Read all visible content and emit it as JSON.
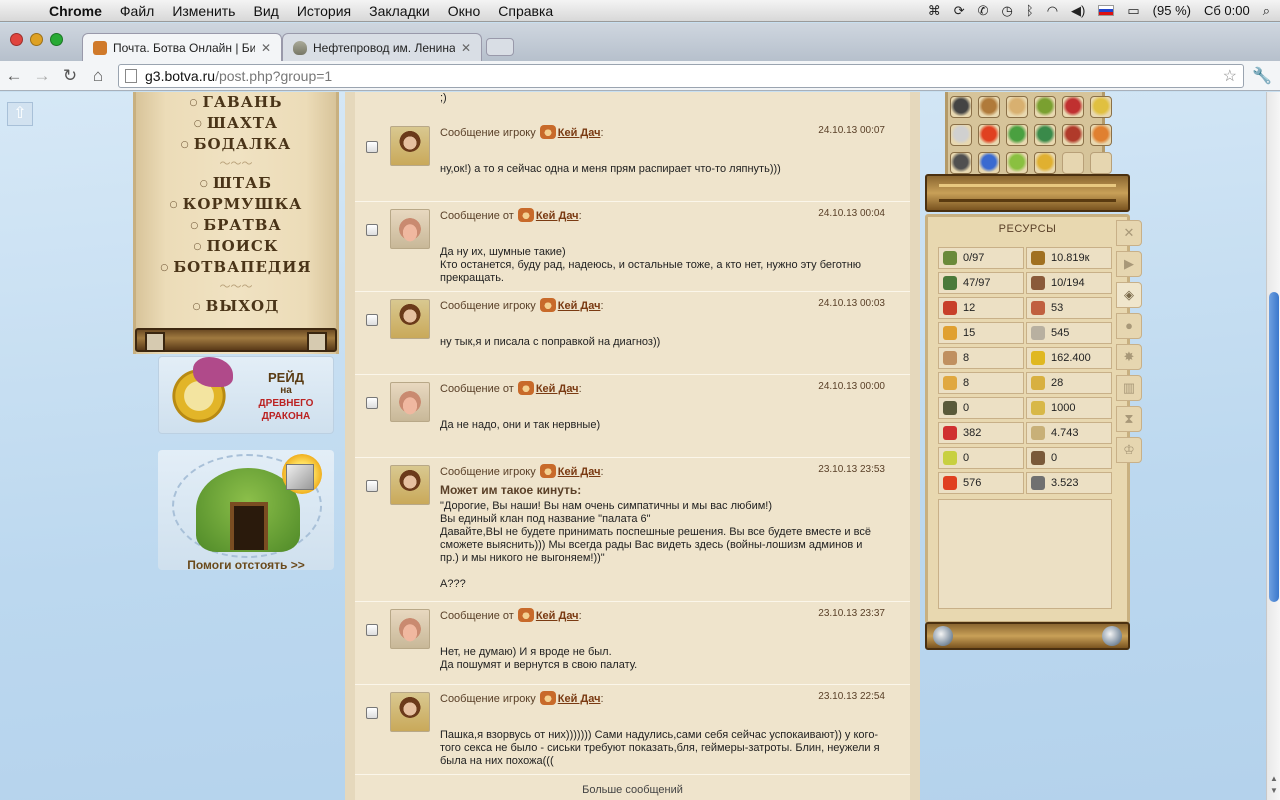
{
  "menubar": {
    "app": "Chrome",
    "items": [
      "Файл",
      "Изменить",
      "Вид",
      "История",
      "Закладки",
      "Окно",
      "Справка"
    ],
    "battery": "(95 %)",
    "clock": "Сб 0:00"
  },
  "tabs": [
    {
      "title": "Почта. Ботва Онлайн | Битва"
    },
    {
      "title": "Нефтепровод им. Ленина"
    }
  ],
  "address": {
    "host": "g3.botva.ru",
    "path": "/post.php?group=1"
  },
  "left_menu": {
    "items_top": [
      "ГАВАНЬ",
      "ШАХТА",
      "БОДАЛКА"
    ],
    "items_mid": [
      "ШТАБ",
      "КОРМУШКА",
      "БРАТВА",
      "ПОИСК",
      "БОТВАПЕДИЯ"
    ],
    "items_bot": [
      "ВЫХОД"
    ]
  },
  "promos": {
    "raid": {
      "line1": "РЕЙД",
      "line2": "на",
      "line3": "ДРЕВНЕГО",
      "line4": "ДРАКОНА"
    },
    "mine": {
      "label": "Помоги отстоять >>"
    }
  },
  "mail": {
    "prev_tail": ";)",
    "more_label": "Больше сообщений",
    "messages": [
      {
        "kind": "to",
        "prefix": "Сообщение игроку",
        "nick": "Кей Дач",
        "date": "24.10.13 00:07",
        "avatar": "girl",
        "body": "ну,ок!) а то я сейчас одна и меня прям распирает что-то ляпнуть)))"
      },
      {
        "kind": "from",
        "prefix": "Сообщение от",
        "nick": "Кей Дач",
        "date": "24.10.13 00:04",
        "avatar": "boar",
        "body": "Да ну их, шумные такие)\nКто останется, буду рад, надеюсь, и остальные тоже, а кто нет, нужно эту беготню прекращать."
      },
      {
        "kind": "to",
        "prefix": "Сообщение игроку",
        "nick": "Кей Дач",
        "date": "24.10.13 00:03",
        "avatar": "girl",
        "body": "ну тык,я и писала с поправкой на диагноз))"
      },
      {
        "kind": "from",
        "prefix": "Сообщение от",
        "nick": "Кей Дач",
        "date": "24.10.13 00:00",
        "avatar": "boar",
        "body": "Да не надо, они и так нервные)"
      },
      {
        "kind": "to",
        "prefix": "Сообщение игроку",
        "nick": "Кей Дач",
        "date": "23.10.13 23:53",
        "avatar": "girl",
        "headline": "Может им такое кинуть:",
        "body": "\"Дорогие, Вы наши! Вы нам очень симпатичны и мы вас любим!)\nВы единый клан под название \"палата 6\"\nДавайте,ВЫ не будете принимать поспешные решения. Вы все будете вместе и всё сможете выяснить))) Мы всегда рады Вас видеть здесь (войны-лошизм админов и пр.) и мы никого не выгоняем!))\"\n\nА???"
      },
      {
        "kind": "from",
        "prefix": "Сообщение от",
        "nick": "Кей Дач",
        "date": "23.10.13 23:37",
        "avatar": "boar",
        "body": "Нет, не думаю) И я вроде не был.\nДа пошумят и вернутся в свою палату."
      },
      {
        "kind": "to",
        "prefix": "Сообщение игроку",
        "nick": "Кей Дач",
        "date": "23.10.13 22:54",
        "avatar": "girl",
        "body": "Пашка,я взорвусь от них))))))) Сами надулись,сами себя сейчас успокаивают)) у кого-того секса не было - сиськи требуют показать,бля, геймеры-затроты. Блин, неужели я была на них похожа((("
      }
    ]
  },
  "resources": {
    "title": "РЕСУРСЫ",
    "cells": [
      {
        "value": "0/97",
        "color": "#6a8a3a"
      },
      {
        "value": "10.819к",
        "color": "#a07020"
      },
      {
        "value": "47/97",
        "color": "#4a7a3a"
      },
      {
        "value": "10/194",
        "color": "#8a5a3a"
      },
      {
        "value": "12",
        "color": "#c8402a"
      },
      {
        "value": "53",
        "color": "#c06040"
      },
      {
        "value": "15",
        "color": "#e0a030"
      },
      {
        "value": "545",
        "color": "#b8b0a0"
      },
      {
        "value": "8",
        "color": "#c09060"
      },
      {
        "value": "162.400",
        "color": "#e0b820"
      },
      {
        "value": "8",
        "color": "#e0a840"
      },
      {
        "value": "28",
        "color": "#d8b040"
      },
      {
        "value": "0",
        "color": "#5a5a3a"
      },
      {
        "value": "1000",
        "color": "#d8b848"
      },
      {
        "value": "382",
        "color": "#d03030"
      },
      {
        "value": "4.743",
        "color": "#c8b078"
      },
      {
        "value": "0",
        "color": "#c8d040"
      },
      {
        "value": "0",
        "color": "#7a5a3a"
      },
      {
        "value": "576",
        "color": "#e04020"
      },
      {
        "value": "3.523",
        "color": "#707070"
      }
    ]
  },
  "inventory": {
    "slots": [
      "#444444",
      "#b07a3a",
      "#d8b070",
      "#7aa030",
      "#c03030",
      "#e0c040",
      "#d0d0d0",
      "#e04020",
      "#4aa040",
      "#3a8a4a",
      "#b03a2a",
      "#e08030",
      "#505050",
      "#3a6ad0",
      "#8ac040",
      "#e0b030",
      "empty",
      "empty"
    ]
  }
}
